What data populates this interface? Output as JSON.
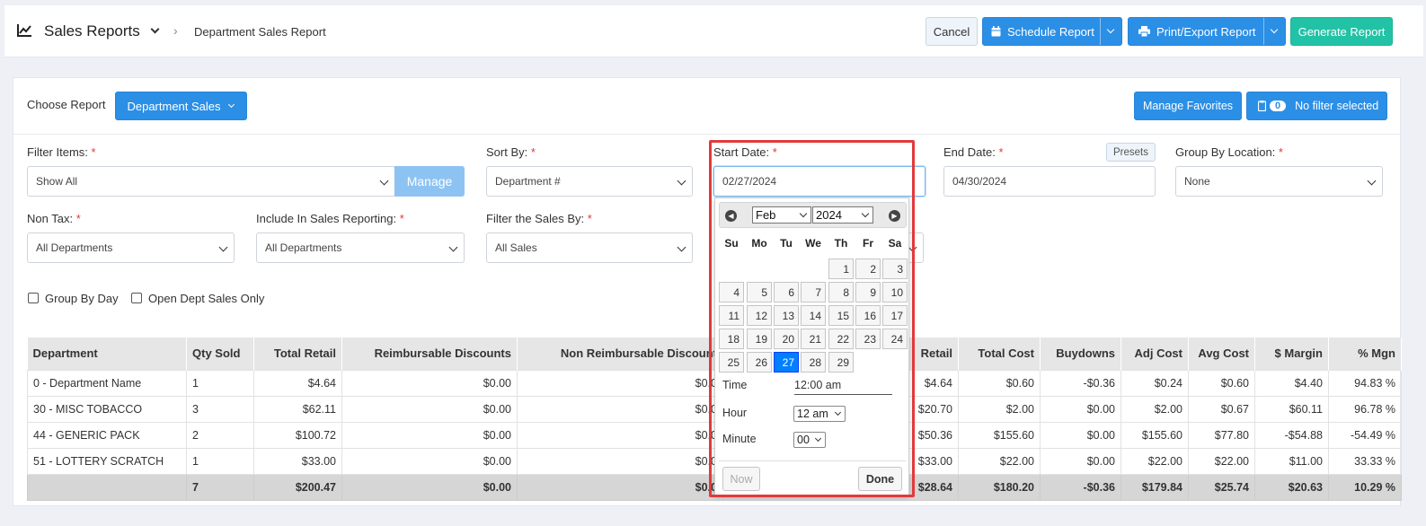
{
  "header": {
    "title": "Sales Reports",
    "breadcrumb": "Department Sales Report",
    "cancel_label": "Cancel",
    "schedule_label": "Schedule Report",
    "print_label": "Print/Export Report",
    "generate_label": "Generate Report"
  },
  "toolbar": {
    "choose_report_label": "Choose Report",
    "report_value": "Department Sales",
    "manage_favorites_label": "Manage Favorites",
    "filter_count": "0",
    "filter_status": "No filter selected"
  },
  "filters": {
    "filter_items_label": "Filter Items:",
    "filter_items_value": "Show All",
    "manage_label": "Manage",
    "sort_by_label": "Sort By:",
    "sort_by_value": "Department #",
    "start_date_label": "Start Date:",
    "start_date_value": "02/27/2024",
    "end_date_label": "End Date:",
    "end_date_value": "04/30/2024",
    "presets_label": "Presets",
    "group_by_location_label": "Group By Location:",
    "group_by_location_value": "None",
    "non_tax_label": "Non Tax:",
    "non_tax_value": "All Departments",
    "include_label": "Include In Sales Reporting:",
    "include_value": "All Departments",
    "filter_sales_label": "Filter the Sales By:",
    "filter_sales_value": "All Sales",
    "group_by_day_label": "Group By Day",
    "open_dept_label": "Open Dept Sales Only",
    "required_mark": "*"
  },
  "table": {
    "headers": [
      "Department",
      "Qty Sold",
      "Total Retail",
      "Reimbursable Discounts",
      "Non Reimbursable Discount",
      "Retail",
      "Total Cost",
      "Buydowns",
      "Adj Cost",
      "Avg Cost",
      "$ Margin",
      "% Mgn"
    ],
    "rows": [
      [
        "0 - Department Name",
        "1",
        "$4.64",
        "$0.00",
        "$0.0",
        "$4.64",
        "$0.60",
        "-$0.36",
        "$0.24",
        "$0.60",
        "$4.40",
        "94.83 %"
      ],
      [
        "30 - MISC TOBACCO",
        "3",
        "$62.11",
        "$0.00",
        "$0.0",
        "$20.70",
        "$2.00",
        "$0.00",
        "$2.00",
        "$0.67",
        "$60.11",
        "96.78 %"
      ],
      [
        "44 - GENERIC PACK",
        "2",
        "$100.72",
        "$0.00",
        "$0.0",
        "$50.36",
        "$155.60",
        "$0.00",
        "$155.60",
        "$77.80",
        "-$54.88",
        "-54.49 %"
      ],
      [
        "51 - LOTTERY SCRATCH",
        "1",
        "$33.00",
        "$0.00",
        "$0.0",
        "$33.00",
        "$22.00",
        "$0.00",
        "$22.00",
        "$22.00",
        "$11.00",
        "33.33 %"
      ]
    ],
    "totals": [
      "",
      "7",
      "$200.47",
      "$0.00",
      "$0.0",
      "$28.64",
      "$180.20",
      "-$0.36",
      "$179.84",
      "$25.74",
      "$20.63",
      "10.29 %"
    ]
  },
  "datepicker": {
    "month": "Feb",
    "year": "2024",
    "weekdays": [
      "Su",
      "Mo",
      "Tu",
      "We",
      "Th",
      "Fr",
      "Sa"
    ],
    "days": [
      "1",
      "2",
      "3",
      "4",
      "5",
      "6",
      "7",
      "8",
      "9",
      "10",
      "11",
      "12",
      "13",
      "14",
      "15",
      "16",
      "17",
      "18",
      "19",
      "20",
      "21",
      "22",
      "23",
      "24",
      "25",
      "26",
      "27",
      "28",
      "29"
    ],
    "selected_day": "27",
    "time_label": "Time",
    "time_value": "12:00 am",
    "hour_label": "Hour",
    "hour_value": "12 am",
    "minute_label": "Minute",
    "minute_value": "00",
    "now_label": "Now",
    "done_label": "Done"
  },
  "colors": {
    "primary": "#2b8fe6",
    "accent": "#21c2a6",
    "link": "#2a88c8",
    "required": "#e53935",
    "highlight": "#e23a3a",
    "selected_day": "#007fff"
  }
}
